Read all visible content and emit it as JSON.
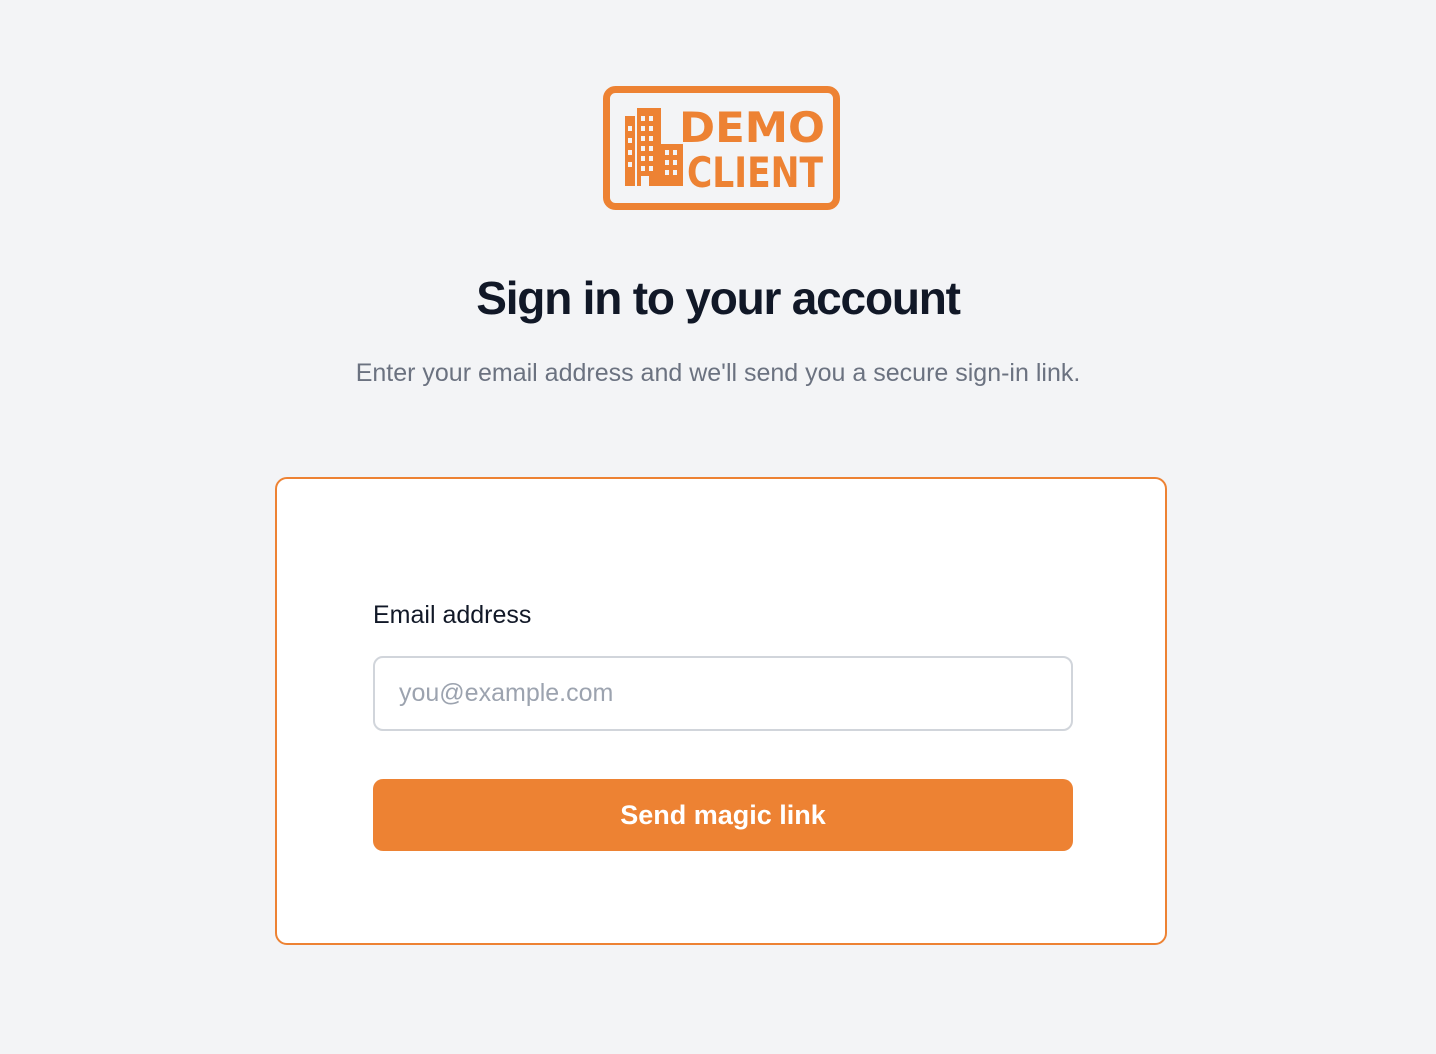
{
  "brand": {
    "logo_line1": "DEMO",
    "logo_line2": "CLIENT",
    "accent_color": "#ed8233",
    "icon": "building-icon"
  },
  "heading": {
    "title": "Sign in to your account",
    "subtitle": "Enter your email address and we'll send you a secure sign-in link."
  },
  "form": {
    "email_label": "Email address",
    "email_placeholder": "you@example.com",
    "email_value": "",
    "submit_label": "Send magic link"
  }
}
